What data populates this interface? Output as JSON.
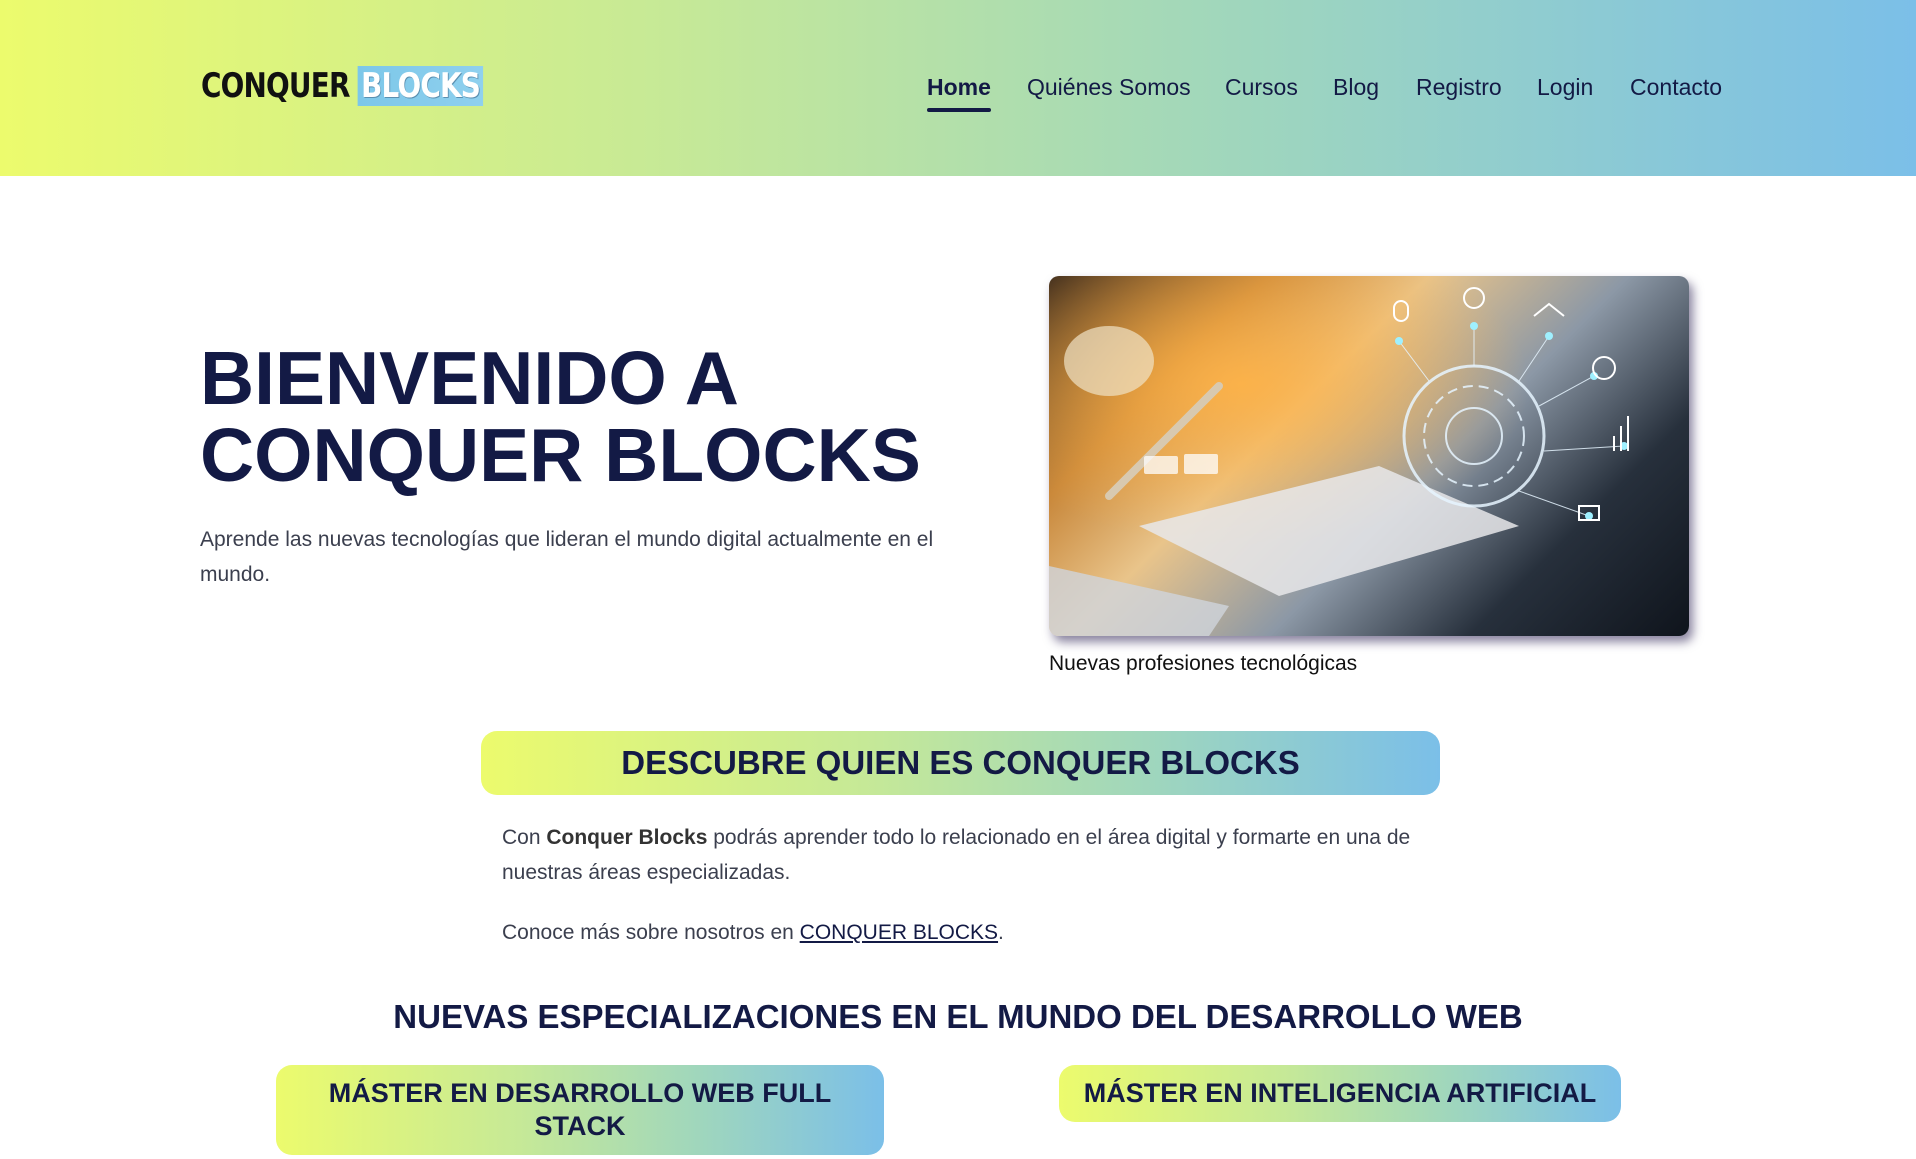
{
  "header": {
    "logo_part1": "CONQUER",
    "logo_part2": "BLOCKS",
    "nav": [
      {
        "label": "Home",
        "active": true
      },
      {
        "label": "Quiénes Somos",
        "active": false
      },
      {
        "label": "Cursos",
        "active": false
      },
      {
        "label": "Blog",
        "active": false
      },
      {
        "label": "Registro",
        "active": false
      },
      {
        "label": "Login",
        "active": false
      },
      {
        "label": "Contacto",
        "active": false
      }
    ],
    "gradient_colors": [
      "#ecfb6d",
      "#c6e997",
      "#9fd6bd",
      "#7bbfe8"
    ]
  },
  "hero": {
    "title": "BIENVENIDO A CONQUER BLOCKS",
    "subtitle": "Aprende las nuevas tecnologías que lideran el mundo digital actualmente en el mundo.",
    "image_caption": "Nuevas profesiones tecnológicas"
  },
  "about": {
    "heading": "DESCUBRE QUIEN ES CONQUER BLOCKS",
    "p1_before": "Con ",
    "p1_bold": "Conquer Blocks",
    "p1_after": " podrás aprender todo lo relacionado en el área digital y formarte en una de nuestras áreas especializadas.",
    "p2_before": "Conoce más sobre nosotros en ",
    "p2_link": "CONQUER BLOCKS",
    "p2_after": "."
  },
  "specializations": {
    "heading": "NUEVAS ESPECIALIZACIONES EN EL MUNDO DEL DESARROLLO WEB",
    "cards": [
      {
        "title": "MÁSTER EN DESARROLLO WEB FULL STACK"
      },
      {
        "title": "MÁSTER EN INTELIGENCIA ARTIFICIAL"
      }
    ]
  },
  "colors": {
    "text_dark": "#131a45",
    "body_text": "#3b3f4e"
  }
}
